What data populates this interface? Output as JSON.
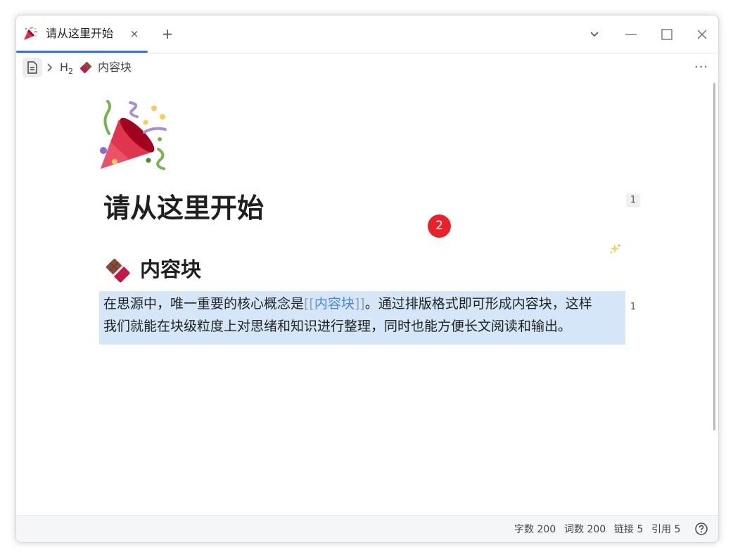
{
  "tab": {
    "title": "请从这里开始",
    "close": "×",
    "add": "+",
    "icon": "party-popper-icon"
  },
  "window_controls": {
    "dropdown_icon": "chevron-down-icon",
    "minimize_icon": "minimize-icon",
    "maximize_icon": "maximize-icon",
    "close_icon": "close-icon"
  },
  "breadcrumb": {
    "doc_icon": "document-icon",
    "heading_level": "H",
    "heading_level_sub": "2",
    "heading_icon": "chocolate-icon",
    "label": "内容块",
    "more": "···"
  },
  "document": {
    "title": "请从这里开始",
    "title_ref_count": "1",
    "notification_badge": "2",
    "heading": "内容块",
    "heading_icon": "chocolate-icon",
    "paragraph": {
      "before": "在思源中，唯一重要的核心概念是",
      "link_open": "[[",
      "link": "内容块",
      "link_close": "]]",
      "after_line1": "。通过排版格式即可形成内容块，这样",
      "line2": "我们就能在块级粒度上对思绪和知识进行整理，同时也能方便长文阅读和输出。"
    },
    "paragraph_ref_count": "1"
  },
  "status": {
    "chars": "字数 200",
    "words": "词数 200",
    "links": "链接 5",
    "refs": "引用 5",
    "help_icon": "help-icon"
  },
  "colors": {
    "accent": "#3574d4",
    "selection": "#d4e6f8",
    "badge": "#e8222a",
    "link": "#4d87d9"
  }
}
